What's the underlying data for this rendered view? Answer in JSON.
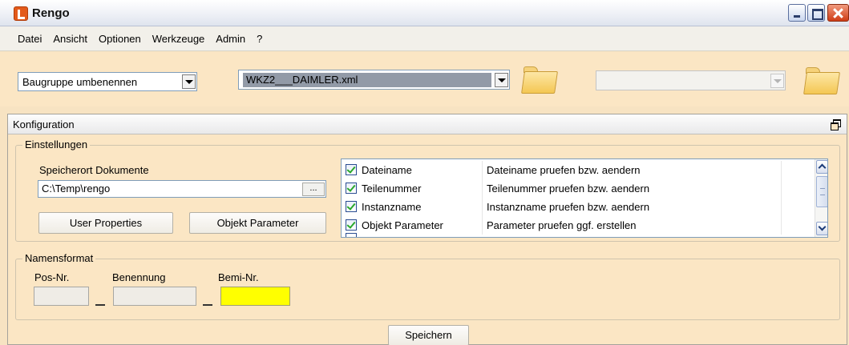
{
  "window": {
    "title": "Rengo"
  },
  "menu": {
    "items": [
      "Datei",
      "Ansicht",
      "Optionen",
      "Werkzeuge",
      "Admin",
      "?"
    ]
  },
  "toolbar": {
    "task_select": "Baugruppe umbenennen",
    "file_select": "WKZ2___DAIMLER.xml",
    "second_select": ""
  },
  "config": {
    "title": "Konfiguration",
    "settings": {
      "group_label": "Einstellungen",
      "storage_label": "Speicherort Dokumente",
      "storage_path": "C:\\Temp\\rengo",
      "browse_label": "...",
      "user_properties_label": "User Properties",
      "objekt_parameter_label": "Objekt Parameter",
      "checklist": [
        {
          "name": "Dateiname",
          "description": "Dateiname pruefen bzw. aendern",
          "checked": true
        },
        {
          "name": "Teilenummer",
          "description": "Teilenummer pruefen bzw. aendern",
          "checked": true
        },
        {
          "name": "Instanzname",
          "description": "Instanzname pruefen bzw. aendern",
          "checked": true
        },
        {
          "name": "Objekt Parameter",
          "description": "Parameter pruefen ggf. erstellen",
          "checked": true
        }
      ]
    },
    "name_format": {
      "group_label": "Namensformat",
      "pos_label": "Pos-Nr.",
      "benennung_label": "Benennung",
      "bemi_label": "Bemi-Nr.",
      "pos_value": "",
      "benennung_value": "",
      "bemi_value": ""
    },
    "save_label": "Speichern"
  },
  "colors": {
    "panel_background": "#fbe6c4",
    "highlight_field": "#ffff00",
    "check_mark": "#2aa82c"
  }
}
